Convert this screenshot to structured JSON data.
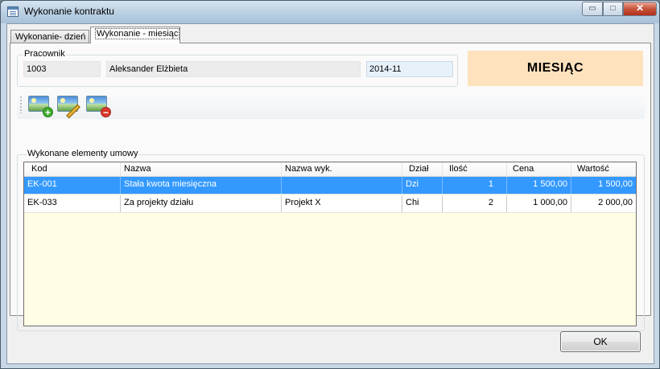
{
  "window": {
    "title": "Wykonanie kontraktu",
    "minimize_glyph": "▭",
    "maximize_glyph": "□",
    "close_glyph": "✕"
  },
  "tabs": [
    {
      "label": "Wykonanie- dzień",
      "active": false
    },
    {
      "label": "Wykonanie - miesiąc",
      "active": true
    }
  ],
  "employee": {
    "group_label": "Pracownik",
    "id": "1003",
    "name": "Aleksander Elżbieta",
    "period": "2014-11"
  },
  "mode_badge": "MIESIĄC",
  "toolbar": {
    "buttons": [
      {
        "name": "add-item-button",
        "icon": "image-add-icon",
        "glyph": "+"
      },
      {
        "name": "edit-item-button",
        "icon": "image-edit-icon",
        "glyph": ""
      },
      {
        "name": "remove-item-button",
        "icon": "image-remove-icon",
        "glyph": "−"
      }
    ]
  },
  "items": {
    "group_label": "Wykonane elementy umowy",
    "columns": [
      "Kod",
      "Nazwa",
      "Nazwa wyk.",
      "Dział",
      "Ilość",
      "Cena",
      "Wartość"
    ],
    "rows": [
      {
        "kod": "EK-001",
        "nazwa": "Stała kwota miesięczna",
        "nazwa_wyk": "",
        "dzial": "Dzi",
        "ilosc": "1",
        "cena": "1 500,00",
        "wartosc": "1 500,00",
        "selected": true
      },
      {
        "kod": "EK-033",
        "nazwa": "Za projekty działu",
        "nazwa_wyk": "Projekt X",
        "dzial": "Chi",
        "ilosc": "2",
        "cena": "1 000,00",
        "wartosc": "2 000,00",
        "selected": false
      }
    ]
  },
  "ok_label": "OK",
  "colors": {
    "selection": "#3399ff",
    "grid_background": "#fffde3",
    "badge_background": "#fde2bd"
  }
}
